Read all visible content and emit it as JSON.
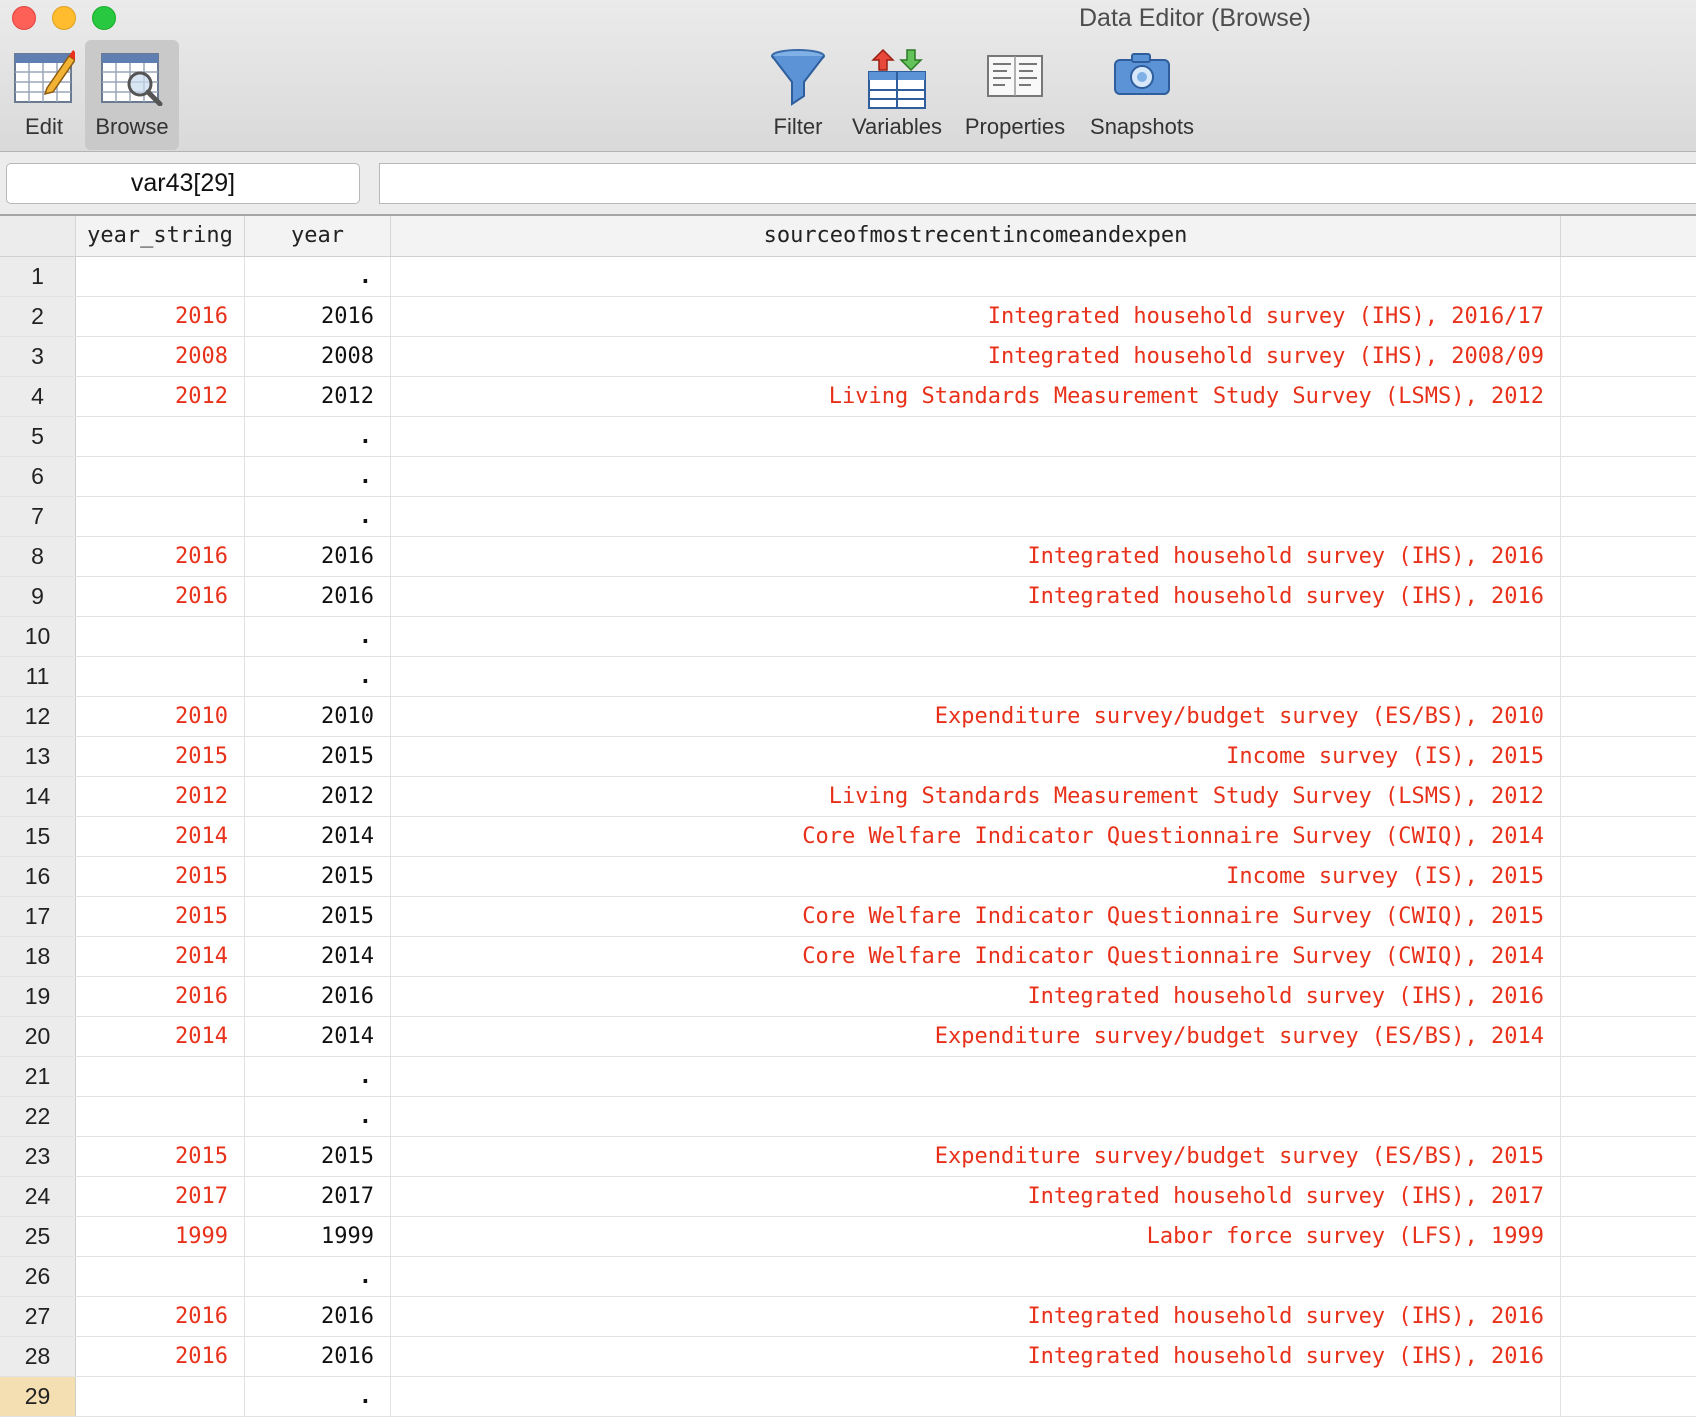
{
  "window": {
    "title": "Data Editor (Browse)"
  },
  "toolbar": {
    "edit_label": "Edit",
    "browse_label": "Browse",
    "filter_label": "Filter",
    "variables_label": "Variables",
    "properties_label": "Properties",
    "snapshots_label": "Snapshots"
  },
  "varbar": {
    "current_cell": "var43[29]",
    "value": ""
  },
  "grid": {
    "columns": [
      "year_string",
      "year",
      "sourceofmostrecentincomeandexpen"
    ],
    "selected_row": 29,
    "rows": [
      {
        "n": "1",
        "year_string": "",
        "year": ".",
        "source": ""
      },
      {
        "n": "2",
        "year_string": "2016",
        "year": "2016",
        "source": "Integrated household survey (IHS), 2016/17"
      },
      {
        "n": "3",
        "year_string": "2008",
        "year": "2008",
        "source": "Integrated household survey (IHS), 2008/09"
      },
      {
        "n": "4",
        "year_string": "2012",
        "year": "2012",
        "source": "Living Standards Measurement Study Survey (LSMS), 2012"
      },
      {
        "n": "5",
        "year_string": "",
        "year": ".",
        "source": ""
      },
      {
        "n": "6",
        "year_string": "",
        "year": ".",
        "source": ""
      },
      {
        "n": "7",
        "year_string": "",
        "year": ".",
        "source": ""
      },
      {
        "n": "8",
        "year_string": "2016",
        "year": "2016",
        "source": "Integrated household survey (IHS), 2016"
      },
      {
        "n": "9",
        "year_string": "2016",
        "year": "2016",
        "source": "Integrated household survey (IHS), 2016"
      },
      {
        "n": "10",
        "year_string": "",
        "year": ".",
        "source": ""
      },
      {
        "n": "11",
        "year_string": "",
        "year": ".",
        "source": ""
      },
      {
        "n": "12",
        "year_string": "2010",
        "year": "2010",
        "source": "Expenditure survey/budget survey (ES/BS), 2010"
      },
      {
        "n": "13",
        "year_string": "2015",
        "year": "2015",
        "source": "Income survey (IS), 2015"
      },
      {
        "n": "14",
        "year_string": "2012",
        "year": "2012",
        "source": "Living Standards Measurement Study Survey (LSMS), 2012"
      },
      {
        "n": "15",
        "year_string": "2014",
        "year": "2014",
        "source": "Core Welfare Indicator Questionnaire Survey (CWIQ), 2014"
      },
      {
        "n": "16",
        "year_string": "2015",
        "year": "2015",
        "source": "Income survey (IS), 2015"
      },
      {
        "n": "17",
        "year_string": "2015",
        "year": "2015",
        "source": "Core Welfare Indicator Questionnaire Survey (CWIQ), 2015"
      },
      {
        "n": "18",
        "year_string": "2014",
        "year": "2014",
        "source": "Core Welfare Indicator Questionnaire Survey (CWIQ), 2014"
      },
      {
        "n": "19",
        "year_string": "2016",
        "year": "2016",
        "source": "Integrated household survey (IHS), 2016"
      },
      {
        "n": "20",
        "year_string": "2014",
        "year": "2014",
        "source": "Expenditure survey/budget survey (ES/BS), 2014"
      },
      {
        "n": "21",
        "year_string": "",
        "year": ".",
        "source": ""
      },
      {
        "n": "22",
        "year_string": "",
        "year": ".",
        "source": ""
      },
      {
        "n": "23",
        "year_string": "2015",
        "year": "2015",
        "source": "Expenditure survey/budget survey (ES/BS), 2015"
      },
      {
        "n": "24",
        "year_string": "2017",
        "year": "2017",
        "source": "Integrated household survey (IHS), 2017"
      },
      {
        "n": "25",
        "year_string": "1999",
        "year": "1999",
        "source": "Labor force survey (LFS), 1999"
      },
      {
        "n": "26",
        "year_string": "",
        "year": ".",
        "source": ""
      },
      {
        "n": "27",
        "year_string": "2016",
        "year": "2016",
        "source": "Integrated household survey (IHS), 2016"
      },
      {
        "n": "28",
        "year_string": "2016",
        "year": "2016",
        "source": "Integrated household survey (IHS), 2016"
      },
      {
        "n": "29",
        "year_string": "",
        "year": ".",
        "source": ""
      }
    ]
  },
  "colors": {
    "string_text": "#e8311a",
    "numeric_text": "#111111",
    "selected_row_header": "#f3dfb2"
  }
}
